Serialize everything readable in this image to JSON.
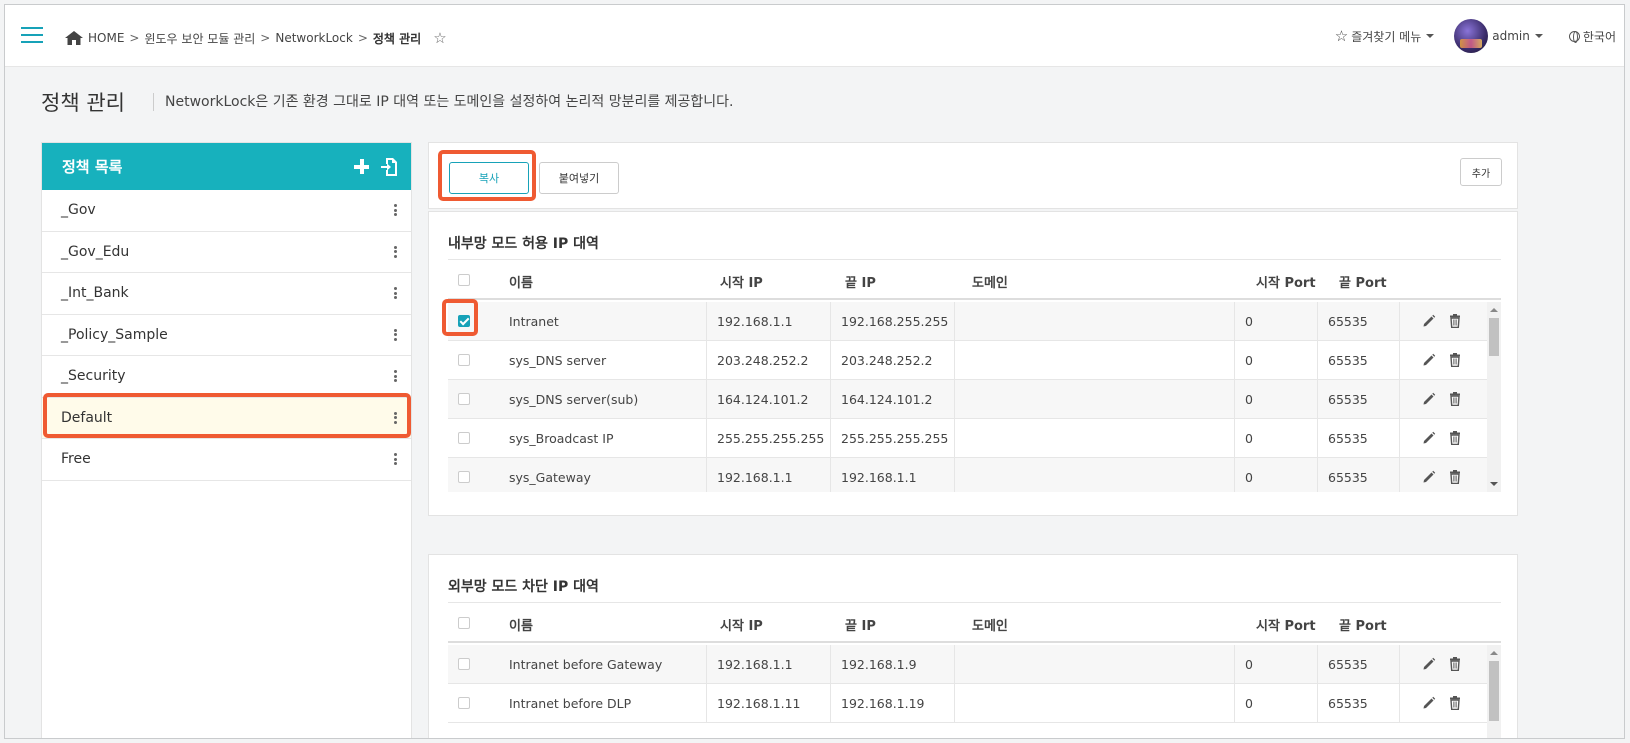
{
  "header": {
    "breadcrumb": [
      "HOME",
      "윈도우 보안 모듈 관리",
      "NetworkLock",
      "정책 관리"
    ],
    "separator": ">",
    "favorites_label": "즐겨찾기 메뉴",
    "username": "admin",
    "language": "한국어"
  },
  "page": {
    "title": "정책 관리",
    "description": "NetworkLock은 기존 환경 그대로 IP 대역 또는 도메인을 설정하여 논리적 망분리를 제공합니다."
  },
  "policy_list": {
    "title": "정책 목록",
    "items": [
      "_Gov",
      "_Gov_Edu",
      "_Int_Bank",
      "_Policy_Sample",
      "_Security",
      "Default",
      "Free"
    ],
    "selected": "Default"
  },
  "toolbar": {
    "copy_label": "복사",
    "paste_label": "붙여넣기",
    "add_label": "추가"
  },
  "columns": [
    "이름",
    "시작 IP",
    "끝 IP",
    "도메인",
    "시작 Port",
    "끝 Port"
  ],
  "internal": {
    "title": "내부망 모드 허용 IP 대역",
    "rows": [
      {
        "name": "Intranet",
        "start_ip": "192.168.1.1",
        "end_ip": "192.168.255.255",
        "domain": "",
        "start_port": "0",
        "end_port": "65535",
        "checked": true
      },
      {
        "name": "sys_DNS server",
        "start_ip": "203.248.252.2",
        "end_ip": "203.248.252.2",
        "domain": "",
        "start_port": "0",
        "end_port": "65535",
        "checked": false
      },
      {
        "name": "sys_DNS server(sub)",
        "start_ip": "164.124.101.2",
        "end_ip": "164.124.101.2",
        "domain": "",
        "start_port": "0",
        "end_port": "65535",
        "checked": false
      },
      {
        "name": "sys_Broadcast IP",
        "start_ip": "255.255.255.255",
        "end_ip": "255.255.255.255",
        "domain": "",
        "start_port": "0",
        "end_port": "65535",
        "checked": false
      },
      {
        "name": "sys_Gateway",
        "start_ip": "192.168.1.1",
        "end_ip": "192.168.1.1",
        "domain": "",
        "start_port": "0",
        "end_port": "65535",
        "checked": false
      }
    ]
  },
  "external": {
    "title": "외부망 모드 차단 IP 대역",
    "rows": [
      {
        "name": "Intranet before Gateway",
        "start_ip": "192.168.1.1",
        "end_ip": "192.168.1.9",
        "domain": "",
        "start_port": "0",
        "end_port": "65535",
        "checked": false
      },
      {
        "name": "Intranet before DLP",
        "start_ip": "192.168.1.11",
        "end_ip": "192.168.1.19",
        "domain": "",
        "start_port": "0",
        "end_port": "65535",
        "checked": false
      }
    ]
  },
  "colors": {
    "accent": "#17b1bd",
    "highlight": "#ef5a32",
    "selected_row": "#fffbea"
  }
}
